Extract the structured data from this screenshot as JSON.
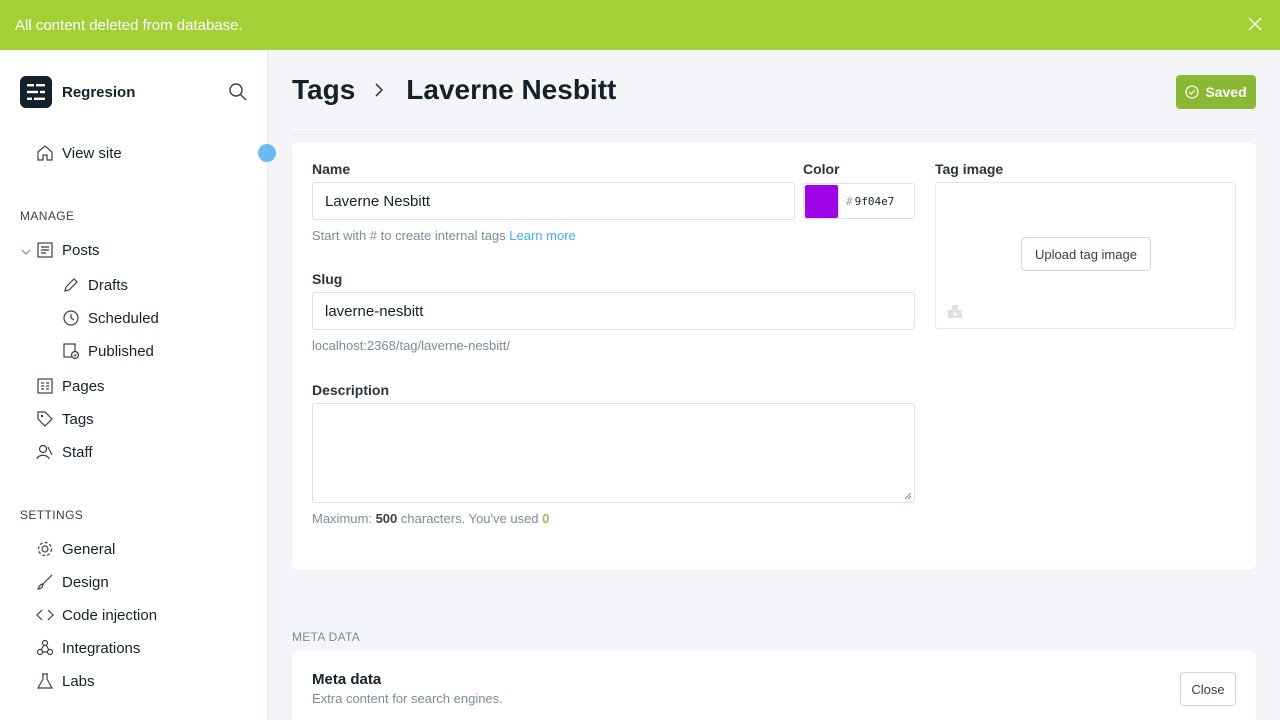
{
  "notification": {
    "message": "All content deleted from database."
  },
  "sidebar": {
    "brand": "Regresion",
    "view_site": "View site",
    "manage_heading": "MANAGE",
    "posts": "Posts",
    "drafts": "Drafts",
    "scheduled": "Scheduled",
    "published": "Published",
    "pages": "Pages",
    "tags": "Tags",
    "staff": "Staff",
    "settings_heading": "SETTINGS",
    "general": "General",
    "design": "Design",
    "code_injection": "Code injection",
    "integrations": "Integrations",
    "labs": "Labs"
  },
  "header": {
    "breadcrumb_parent": "Tags",
    "breadcrumb_current": "Laverne Nesbitt",
    "saved_label": "Saved"
  },
  "form": {
    "name_label": "Name",
    "name_value": "Laverne Nesbitt",
    "name_hint": "Start with # to create internal tags",
    "learn_more": "Learn more",
    "color_label": "Color",
    "color_hash": "#",
    "color_value": "9f04e7",
    "tag_image_label": "Tag image",
    "upload_label": "Upload tag image",
    "slug_label": "Slug",
    "slug_value": "laverne-nesbitt",
    "slug_url": "localhost:2368/tag/laverne-nesbitt/",
    "description_label": "Description",
    "description_value": "",
    "max_prefix": "Maximum:",
    "max_count": "500",
    "max_middle": "characters. You've used",
    "used_count": "0"
  },
  "meta": {
    "section_heading": "META DATA",
    "title": "Meta data",
    "subtitle": "Extra content for search engines.",
    "close_label": "Close"
  },
  "colors": {
    "notification_bg": "#a4d037",
    "saved_bg": "#8bb832",
    "tag_color": "#9f04e7",
    "link": "#3eb0ef"
  }
}
